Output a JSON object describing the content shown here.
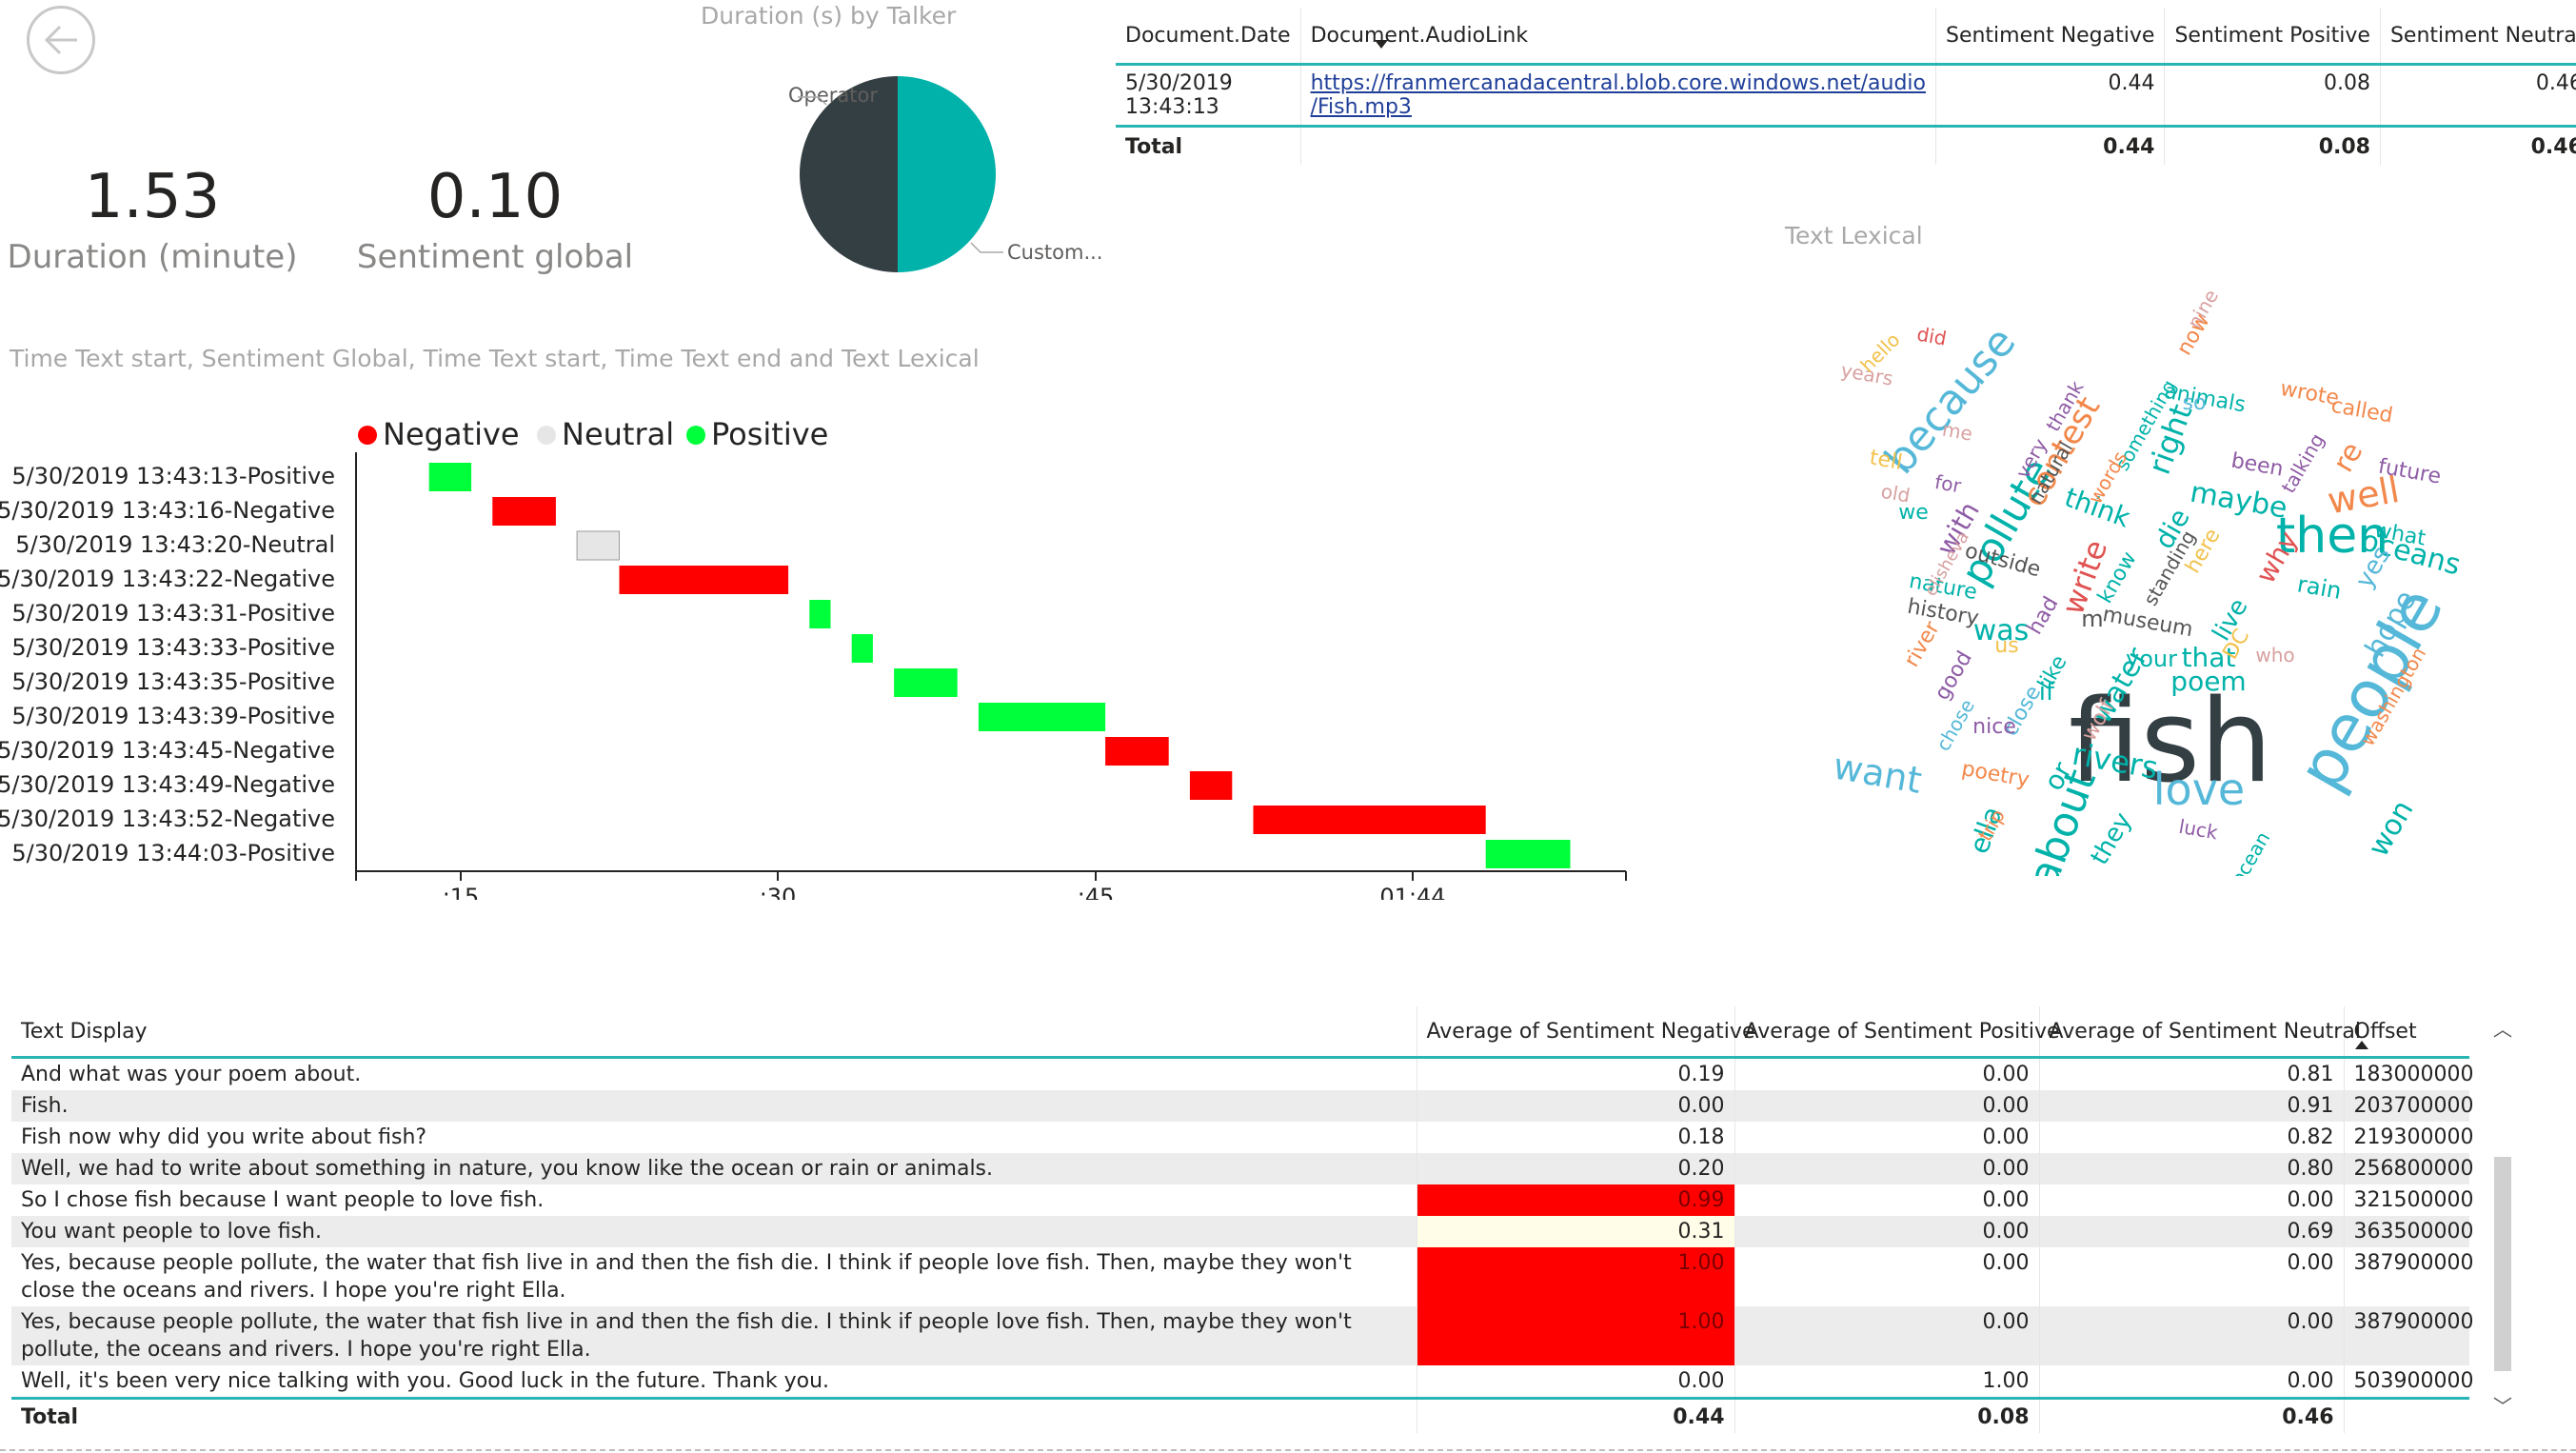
{
  "nav": {
    "back_icon": "back-arrow-icon"
  },
  "kpis": [
    {
      "value": "1.53",
      "label": "Duration (minute)"
    },
    {
      "value": "0.10",
      "label": "Sentiment global"
    }
  ],
  "pie": {
    "title": "Duration (s) by Talker",
    "slices": [
      {
        "label": "Operator",
        "value": 50,
        "color": "#343f43"
      },
      {
        "label": "Custom...",
        "value": 50,
        "color": "#00b2a9"
      }
    ]
  },
  "doc_table": {
    "columns": [
      "Document.Date",
      "Document.AudioLink",
      "Sentiment Negative",
      "Sentiment Positive",
      "Sentiment Neutral"
    ],
    "row": {
      "date": "5/30/2019 13:43:13",
      "link_line1": "https://franmercanadacentral.blob.core.windows.net/audio",
      "link_line2": "/Fish.mp3",
      "neg": "0.44",
      "pos": "0.08",
      "neu": "0.46"
    },
    "total": {
      "label": "Total",
      "neg": "0.44",
      "pos": "0.08",
      "neu": "0.46"
    }
  },
  "gantt": {
    "title": "Time Text start, Sentiment Global, Time Text start, Time Text end and Text Lexical",
    "legend": [
      {
        "label": "Negative",
        "color": "#ff0000"
      },
      {
        "label": "Neutral",
        "color": "#e6e6e6"
      },
      {
        "label": "Positive",
        "color": "#00ff3b"
      }
    ],
    "x_ticks": [
      {
        "label": ":15",
        "t": 15
      },
      {
        "label": ":30",
        "t": 30
      },
      {
        "label": ":45",
        "t": 45
      },
      {
        "label": "01:44",
        "t": 60
      }
    ],
    "rows": [
      {
        "label": "5/30/2019 13:43:13-Positive",
        "sentiment": "Positive",
        "start": 13.5,
        "end": 15.5
      },
      {
        "label": "5/30/2019 13:43:16-Negative",
        "sentiment": "Negative",
        "start": 16.5,
        "end": 19.5
      },
      {
        "label": "5/30/2019 13:43:20-Neutral",
        "sentiment": "Neutral",
        "start": 20.5,
        "end": 22.5
      },
      {
        "label": "5/30/2019 13:43:22-Negative",
        "sentiment": "Negative",
        "start": 22.5,
        "end": 30.5
      },
      {
        "label": "5/30/2019 13:43:31-Positive",
        "sentiment": "Positive",
        "start": 31.5,
        "end": 32.5
      },
      {
        "label": "5/30/2019 13:43:33-Positive",
        "sentiment": "Positive",
        "start": 33.5,
        "end": 34.5
      },
      {
        "label": "5/30/2019 13:43:35-Positive",
        "sentiment": "Positive",
        "start": 35.5,
        "end": 38.5
      },
      {
        "label": "5/30/2019 13:43:39-Positive",
        "sentiment": "Positive",
        "start": 39.5,
        "end": 45.5
      },
      {
        "label": "5/30/2019 13:43:45-Negative",
        "sentiment": "Negative",
        "start": 45.5,
        "end": 48.5
      },
      {
        "label": "5/30/2019 13:43:49-Negative",
        "sentiment": "Negative",
        "start": 49.5,
        "end": 51.5
      },
      {
        "label": "5/30/2019 13:43:52-Negative",
        "sentiment": "Negative",
        "start": 52.5,
        "end": 63.5
      },
      {
        "label": "5/30/2019 13:44:03-Positive",
        "sentiment": "Positive",
        "start": 63.5,
        "end": 67.5
      }
    ]
  },
  "wordcloud": {
    "title": "Text Lexical",
    "words": [
      {
        "w": "fish",
        "c": "#343f43",
        "r": 0
      },
      {
        "w": "people",
        "c": "#56b8d8",
        "r": -60
      },
      {
        "w": "love",
        "c": "#56b8d8",
        "r": 0
      },
      {
        "w": "then",
        "c": "#00b2a9",
        "r": 0
      },
      {
        "w": "about",
        "c": "#00b2a9",
        "r": -70
      },
      {
        "w": "because",
        "c": "#56b8d8",
        "r": -50
      },
      {
        "w": "want",
        "c": "#56b8d8",
        "r": 10
      },
      {
        "w": "pollute",
        "c": "#00b2a9",
        "r": -60
      },
      {
        "w": "well",
        "c": "#f2884b",
        "r": -10
      },
      {
        "w": "contest",
        "c": "#f2884b",
        "r": -60
      },
      {
        "w": "rivers",
        "c": "#00b2a9",
        "r": 10
      },
      {
        "w": "write",
        "c": "#e05252",
        "r": -70
      },
      {
        "w": "maybe",
        "c": "#00b2a9",
        "r": 10
      },
      {
        "w": "oceans",
        "c": "#00b2a9",
        "r": 15
      },
      {
        "w": "think",
        "c": "#00b2a9",
        "r": 20
      },
      {
        "w": "water",
        "c": "#00b2a9",
        "r": -60
      },
      {
        "w": "poem",
        "c": "#00b2a9",
        "r": 0
      },
      {
        "w": "that",
        "c": "#00b2a9",
        "r": 0
      },
      {
        "w": "hope",
        "c": "#56b8d8",
        "r": -60
      },
      {
        "w": "right",
        "c": "#00b2a9",
        "r": -70
      },
      {
        "w": "ella",
        "c": "#00b2a9",
        "r": -70
      },
      {
        "w": "was",
        "c": "#00b2a9",
        "r": 0
      },
      {
        "w": "they",
        "c": "#00b2a9",
        "r": -60
      },
      {
        "w": "live",
        "c": "#00b2a9",
        "r": -60
      },
      {
        "w": "die",
        "c": "#00b2a9",
        "r": -60
      },
      {
        "w": "yes",
        "c": "#56b8d8",
        "r": -60
      },
      {
        "w": "why",
        "c": "#e05252",
        "r": -60
      },
      {
        "w": "re",
        "c": "#f2884b",
        "r": -60
      },
      {
        "w": "won",
        "c": "#00b2a9",
        "r": -60
      },
      {
        "w": "with",
        "c": "#8e5ba5",
        "r": -60
      },
      {
        "w": "museum",
        "c": "#555555",
        "r": 10
      },
      {
        "w": "nature",
        "c": "#00b2a9",
        "r": 10
      },
      {
        "w": "history",
        "c": "#555555",
        "r": 10
      },
      {
        "w": "animals",
        "c": "#00b2a9",
        "r": 10
      },
      {
        "w": "something",
        "c": "#00b2a9",
        "r": -60
      },
      {
        "w": "thank",
        "c": "#8e5ba5",
        "r": -60
      },
      {
        "w": "natural",
        "c": "#555555",
        "r": -60
      },
      {
        "w": "very",
        "c": "#8e5ba5",
        "r": -60
      },
      {
        "w": "words",
        "c": "#f2884b",
        "r": -60
      },
      {
        "w": "standing",
        "c": "#555555",
        "r": -60
      },
      {
        "w": "know",
        "c": "#00b2a9",
        "r": -60
      },
      {
        "w": "outside",
        "c": "#555555",
        "r": 15
      },
      {
        "w": "been",
        "c": "#8e5ba5",
        "r": 10
      },
      {
        "w": "wrote",
        "c": "#f2884b",
        "r": 10
      },
      {
        "w": "called",
        "c": "#f2884b",
        "r": 10
      },
      {
        "w": "future",
        "c": "#8e5ba5",
        "r": 10
      },
      {
        "w": "talking",
        "c": "#8e5ba5",
        "r": -60
      },
      {
        "w": "what",
        "c": "#00b2a9",
        "r": 10
      },
      {
        "w": "washington",
        "c": "#f2884b",
        "r": -60
      },
      {
        "w": "rain",
        "c": "#00b2a9",
        "r": 10
      },
      {
        "w": "who",
        "c": "#d8a0a0",
        "r": 0
      },
      {
        "w": "DC",
        "c": "#f2c14b",
        "r": -60
      },
      {
        "w": "here",
        "c": "#f2c14b",
        "r": -60
      },
      {
        "w": "your",
        "c": "#00b2a9",
        "r": 0
      },
      {
        "w": "or",
        "c": "#00b2a9",
        "r": -60
      },
      {
        "w": "had",
        "c": "#8e5ba5",
        "r": -60
      },
      {
        "w": "like",
        "c": "#00b2a9",
        "r": -60
      },
      {
        "w": "if",
        "c": "#00b2a9",
        "r": 0
      },
      {
        "w": "close",
        "c": "#56b8d8",
        "r": -60
      },
      {
        "w": "nice",
        "c": "#8e5ba5",
        "r": 0
      },
      {
        "w": "chose",
        "c": "#56b8d8",
        "r": -60
      },
      {
        "w": "good",
        "c": "#8e5ba5",
        "r": -60
      },
      {
        "w": "river",
        "c": "#f2884b",
        "r": -60
      },
      {
        "w": "wolf",
        "c": "#d8a0a0",
        "r": -60
      },
      {
        "w": "us",
        "c": "#f2c14b",
        "r": 0
      },
      {
        "w": "poetry",
        "c": "#f2884b",
        "r": 10
      },
      {
        "w": "trip",
        "c": "#f2884b",
        "r": -60
      },
      {
        "w": "luck",
        "c": "#8e5ba5",
        "r": 10
      },
      {
        "w": "ocean",
        "c": "#00b2a9",
        "r": -60
      },
      {
        "w": "elisheva",
        "c": "#d8a0a0",
        "r": -60
      },
      {
        "w": "we",
        "c": "#00b2a9",
        "r": 0
      },
      {
        "w": "for",
        "c": "#8e5ba5",
        "r": 10
      },
      {
        "w": "old",
        "c": "#d8a0a0",
        "r": 10
      },
      {
        "w": "tell",
        "c": "#f2c14b",
        "r": 10
      },
      {
        "w": "me",
        "c": "#d8a0a0",
        "r": 10
      },
      {
        "w": "years",
        "c": "#d8a0a0",
        "r": 10
      },
      {
        "w": "hello",
        "c": "#f2c14b",
        "r": -45
      },
      {
        "w": "did",
        "c": "#e05252",
        "r": 10
      },
      {
        "w": "nine",
        "c": "#d8a0a0",
        "r": -60
      },
      {
        "w": "now",
        "c": "#f2884b",
        "r": -60
      },
      {
        "w": "so",
        "c": "#56b8d8",
        "r": 0
      },
      {
        "w": "m",
        "c": "#555555",
        "r": 0
      }
    ]
  },
  "main_table": {
    "columns": [
      "Text Display",
      "Average of Sentiment Negative",
      "Average of Sentiment Positive",
      "Average of Sentiment Neutral",
      "Offset"
    ],
    "rows": [
      {
        "text": "And what was your poem about.",
        "neg": "0.19",
        "pos": "0.00",
        "neu": "0.81",
        "offset": "183000000",
        "hl": ""
      },
      {
        "text": "Fish.",
        "neg": "0.00",
        "pos": "0.00",
        "neu": "0.91",
        "offset": "203700000",
        "hl": ""
      },
      {
        "text": "Fish now why did you write about fish?",
        "neg": "0.18",
        "pos": "0.00",
        "neu": "0.82",
        "offset": "219300000",
        "hl": ""
      },
      {
        "text": "Well, we had to write about something in nature, you know like the ocean or rain or animals.",
        "neg": "0.20",
        "pos": "0.00",
        "neu": "0.80",
        "offset": "256800000",
        "hl": ""
      },
      {
        "text": "So I chose fish because I want people to love fish.",
        "neg": "0.99",
        "pos": "0.00",
        "neu": "0.00",
        "offset": "321500000",
        "hl": "red"
      },
      {
        "text": "You want people to love fish.",
        "neg": "0.31",
        "pos": "0.00",
        "neu": "0.69",
        "offset": "363500000",
        "hl": "cream"
      },
      {
        "text": "Yes, because people pollute, the water that fish live in and then the fish die. I think if people love fish. Then, maybe they won't close the oceans and rivers. I hope you're right Ella.",
        "neg": "1.00",
        "pos": "0.00",
        "neu": "0.00",
        "offset": "387900000",
        "hl": "red"
      },
      {
        "text": "Yes, because people pollute, the water that fish live in and then the fish die. I think if people love fish. Then, maybe they won't pollute, the oceans and rivers. I hope you're right Ella.",
        "neg": "1.00",
        "pos": "0.00",
        "neu": "0.00",
        "offset": "387900000",
        "hl": "red"
      },
      {
        "text": "Well, it's been very nice talking with you. Good luck in the future. Thank you.",
        "neg": "0.00",
        "pos": "1.00",
        "neu": "0.00",
        "offset": "503900000",
        "hl": ""
      }
    ],
    "total": {
      "label": "Total",
      "neg": "0.44",
      "pos": "0.08",
      "neu": "0.46"
    }
  }
}
